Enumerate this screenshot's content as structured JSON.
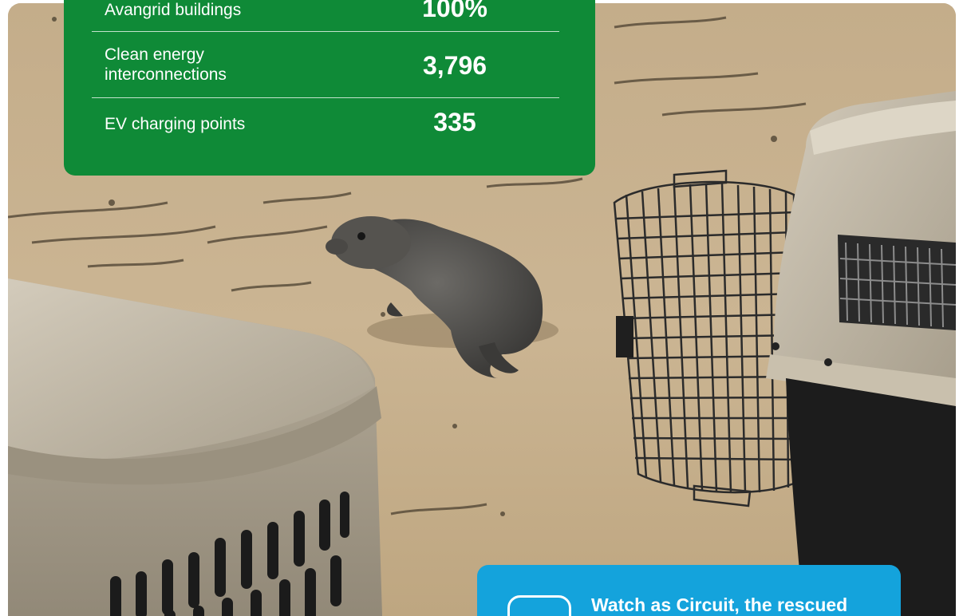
{
  "stats": [
    {
      "label": "Avangrid buildings",
      "value": "100%"
    },
    {
      "label": "Clean energy interconnections",
      "value": "3,796"
    },
    {
      "label": "EV charging points",
      "value": "335"
    }
  ],
  "video": {
    "text": "Watch as Circuit, the rescued"
  },
  "colors": {
    "stats_card": "#0f8a37",
    "video_card": "#14a3dc"
  },
  "icons": [
    "play-icon"
  ]
}
